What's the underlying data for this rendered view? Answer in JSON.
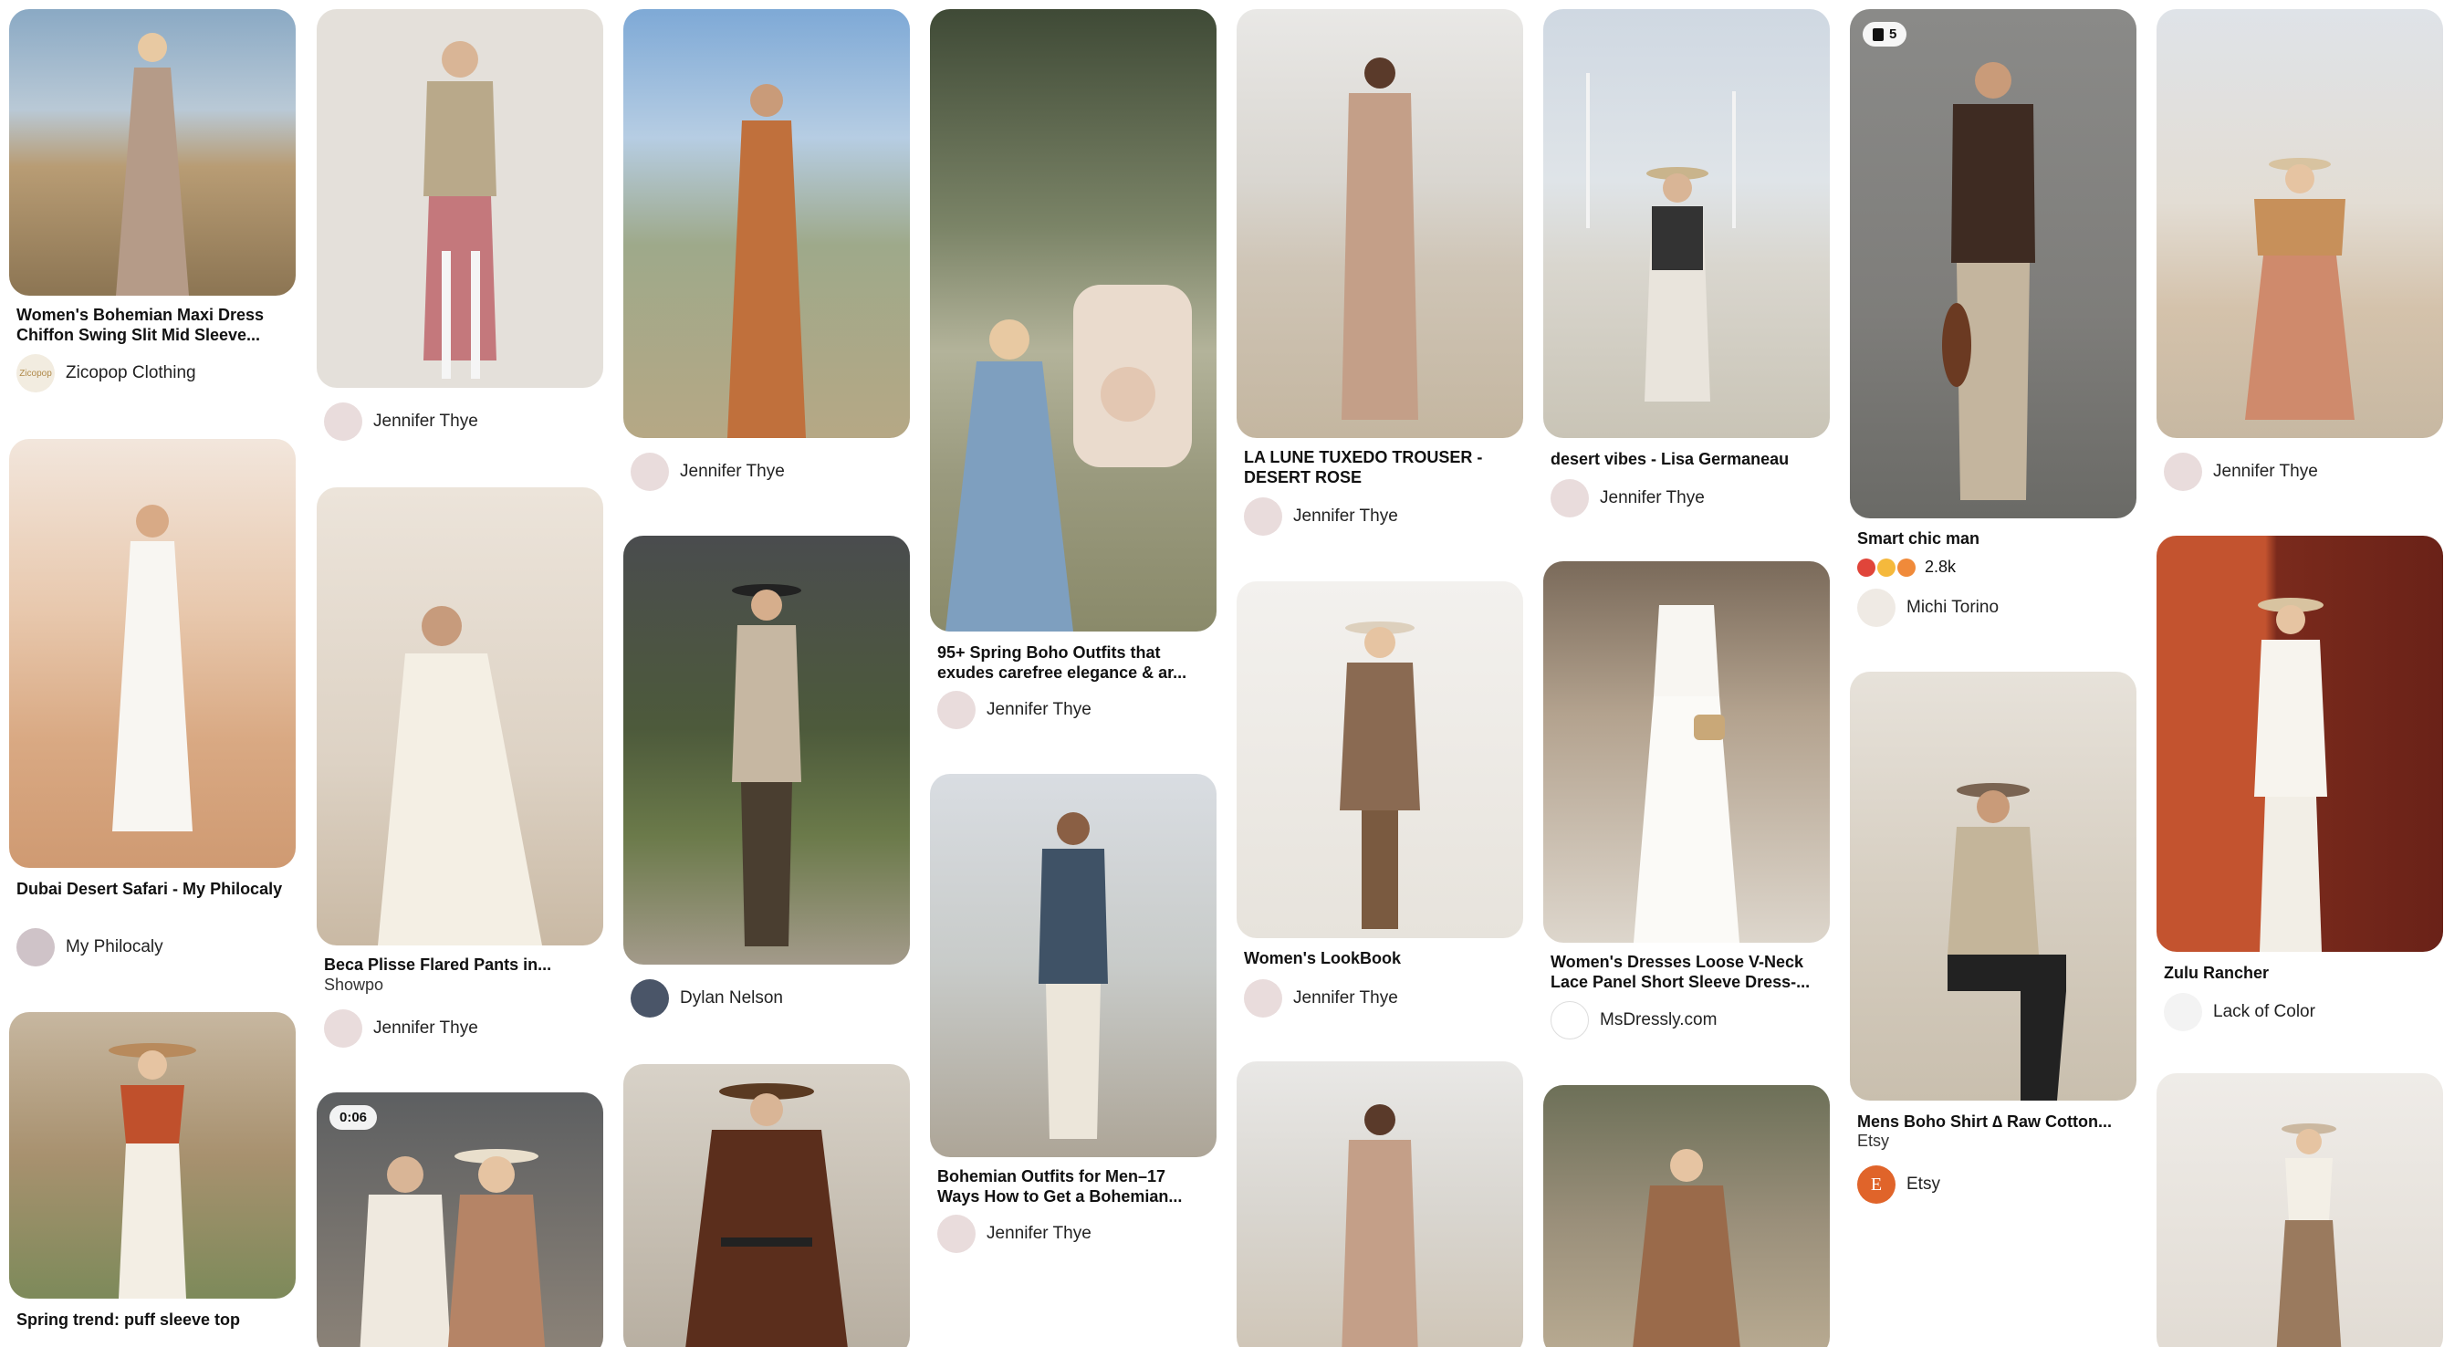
{
  "feed": {
    "pin1": {
      "title": "Women's Bohemian Maxi Dress Chiffon Swing Slit Mid Sleeve...",
      "author": "Zicopop Clothing",
      "avatar_text": "Zicopop"
    },
    "pin2": {
      "title": "Dubai Desert Safari - My Philocaly",
      "author": "My Philocaly"
    },
    "pin3": {
      "title": "Spring trend: puff sleeve top"
    },
    "pin4": {
      "author": "Jennifer Thye"
    },
    "pin5": {
      "title": "Beca Plisse Flared Pants in...",
      "subtitle": "Showpo",
      "author": "Jennifer Thye"
    },
    "pin6": {
      "badge": "0:06"
    },
    "pin7": {
      "author": "Jennifer Thye"
    },
    "pin8": {
      "author": "Dylan Nelson"
    },
    "pin9": {},
    "pin10": {
      "title": "95+ Spring Boho Outfits that exudes carefree elegance & ar...",
      "author": "Jennifer Thye"
    },
    "pin11": {
      "title": "Bohemian Outfits for Men–17 Ways How to Get a Bohemian...",
      "author": "Jennifer Thye"
    },
    "pin12": {
      "title": "LA LUNE TUXEDO TROUSER - DESERT ROSE",
      "author": "Jennifer Thye"
    },
    "pin13": {
      "title": "Women's LookBook",
      "author": "Jennifer Thye"
    },
    "pin14": {},
    "pin15": {
      "title": "desert vibes - Lisa Germaneau",
      "author": "Jennifer Thye"
    },
    "pin16": {
      "title": "Women's Dresses Loose V-Neck Lace Panel Short Sleeve Dress-...",
      "author": "MsDressly.com"
    },
    "pin17": {},
    "pin18": {
      "badge": "5",
      "title": "Smart chic man",
      "reactions": "2.8k",
      "author": "Michi Torino"
    },
    "pin19": {
      "title": "Mens Boho Shirt ∆ Raw Cotton...",
      "subtitle": "Etsy",
      "author": "Etsy",
      "avatar_text": "E"
    },
    "pin20": {
      "author": "Jennifer Thye"
    },
    "pin21": {
      "title": "Zulu Rancher",
      "author": "Lack of Color"
    },
    "pin22": {}
  }
}
